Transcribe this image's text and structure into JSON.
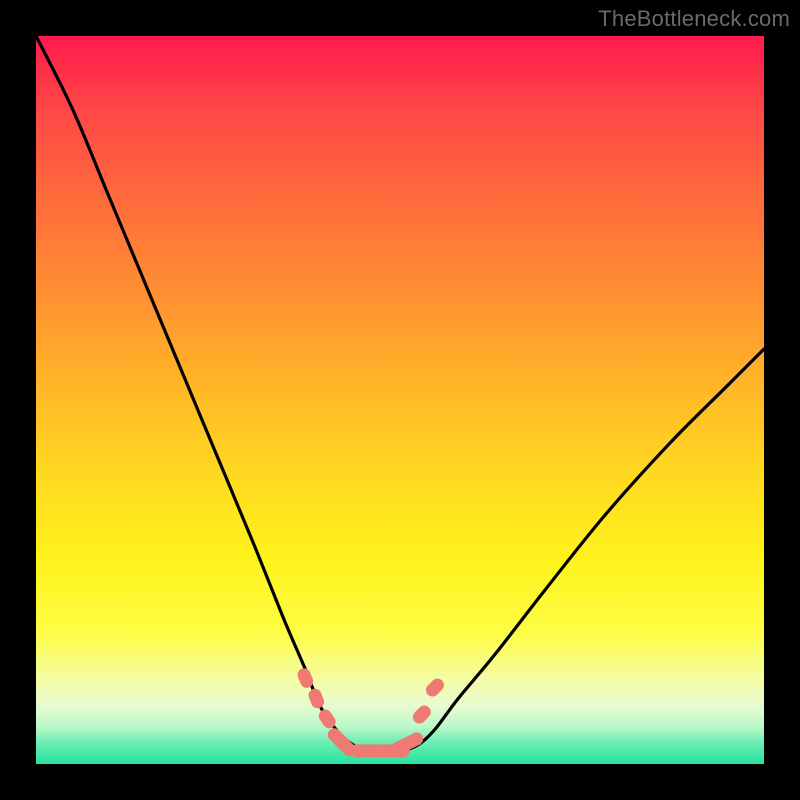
{
  "watermark": {
    "text": "TheBottleneck.com"
  },
  "chart_data": {
    "type": "line",
    "title": "",
    "xlabel": "",
    "ylabel": "",
    "xlim": [
      0,
      1
    ],
    "ylim": [
      0,
      1
    ],
    "curve_note": "Values read off the gradient position (0 = green bottom, 1 = red top). V-shaped bottleneck curve with minimum near x≈0.46.",
    "x": [
      0.0,
      0.05,
      0.1,
      0.15,
      0.2,
      0.25,
      0.3,
      0.34,
      0.37,
      0.39,
      0.41,
      0.43,
      0.45,
      0.47,
      0.49,
      0.51,
      0.53,
      0.55,
      0.58,
      0.63,
      0.7,
      0.78,
      0.87,
      0.95,
      1.0
    ],
    "y": [
      1.0,
      0.9,
      0.78,
      0.66,
      0.54,
      0.42,
      0.3,
      0.2,
      0.13,
      0.08,
      0.05,
      0.03,
      0.02,
      0.02,
      0.02,
      0.02,
      0.03,
      0.05,
      0.09,
      0.15,
      0.24,
      0.34,
      0.44,
      0.52,
      0.57
    ],
    "markers": {
      "description": "Coral capsule-shaped markers along low portion of curve",
      "x": [
        0.37,
        0.385,
        0.4,
        0.42,
        0.455,
        0.49,
        0.51,
        0.53,
        0.548
      ],
      "y": [
        0.118,
        0.09,
        0.062,
        0.03,
        0.018,
        0.018,
        0.028,
        0.068,
        0.105
      ],
      "color": "#ef7a73"
    }
  }
}
